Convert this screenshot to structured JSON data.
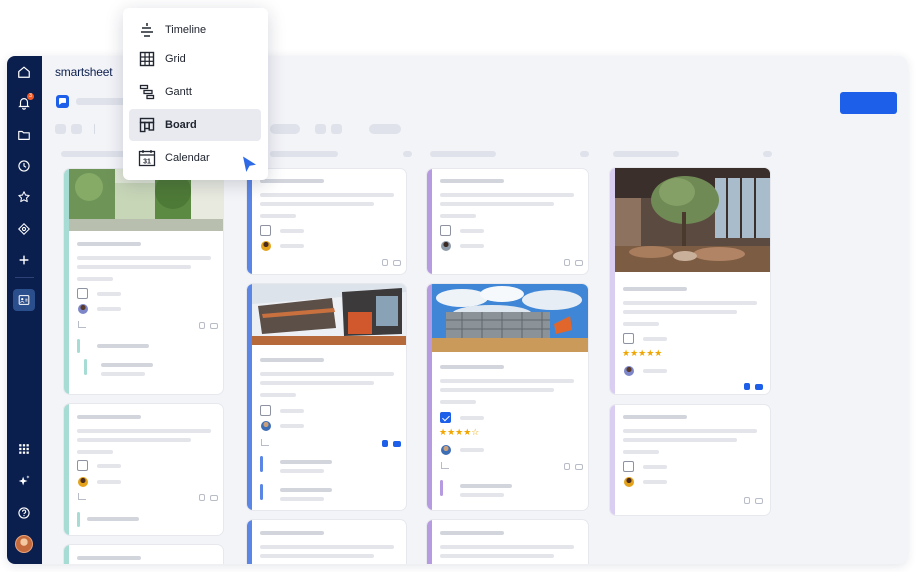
{
  "brand": "smartsheet",
  "sidebar": {
    "items": [
      {
        "name": "home-icon"
      },
      {
        "name": "bell-icon",
        "badge": "3"
      },
      {
        "name": "folder-icon"
      },
      {
        "name": "clock-icon"
      },
      {
        "name": "star-icon"
      },
      {
        "name": "solutions-icon"
      },
      {
        "name": "plus-icon"
      },
      {
        "name": "workspace-icon"
      },
      {
        "name": "apps-grid-icon"
      },
      {
        "name": "ai-sparkle-icon"
      },
      {
        "name": "help-icon"
      },
      {
        "name": "user-avatar"
      }
    ]
  },
  "view_menu": {
    "items": [
      {
        "label": "Timeline",
        "icon": "timeline-icon",
        "selected": false
      },
      {
        "label": "Grid",
        "icon": "grid-icon",
        "selected": false
      },
      {
        "label": "Gantt",
        "icon": "gantt-icon",
        "selected": false
      },
      {
        "label": "Board",
        "icon": "board-icon",
        "selected": true
      },
      {
        "label": "Calendar",
        "icon": "calendar-icon",
        "calendar_day": "31",
        "selected": false
      }
    ]
  },
  "board": {
    "ratings": {
      "card_c2_2": "★★★★☆",
      "card_c3_1": "★★★★★"
    }
  },
  "colors": {
    "accent": "#1d5fe8",
    "sidebar": "#0b1f4f",
    "col1_bar": "#a6dcd4",
    "col2_bar": "#5b86e6",
    "col3_bar": "#b79be0",
    "col4_bar": "#d9cdf2",
    "star": "#f0a500"
  }
}
